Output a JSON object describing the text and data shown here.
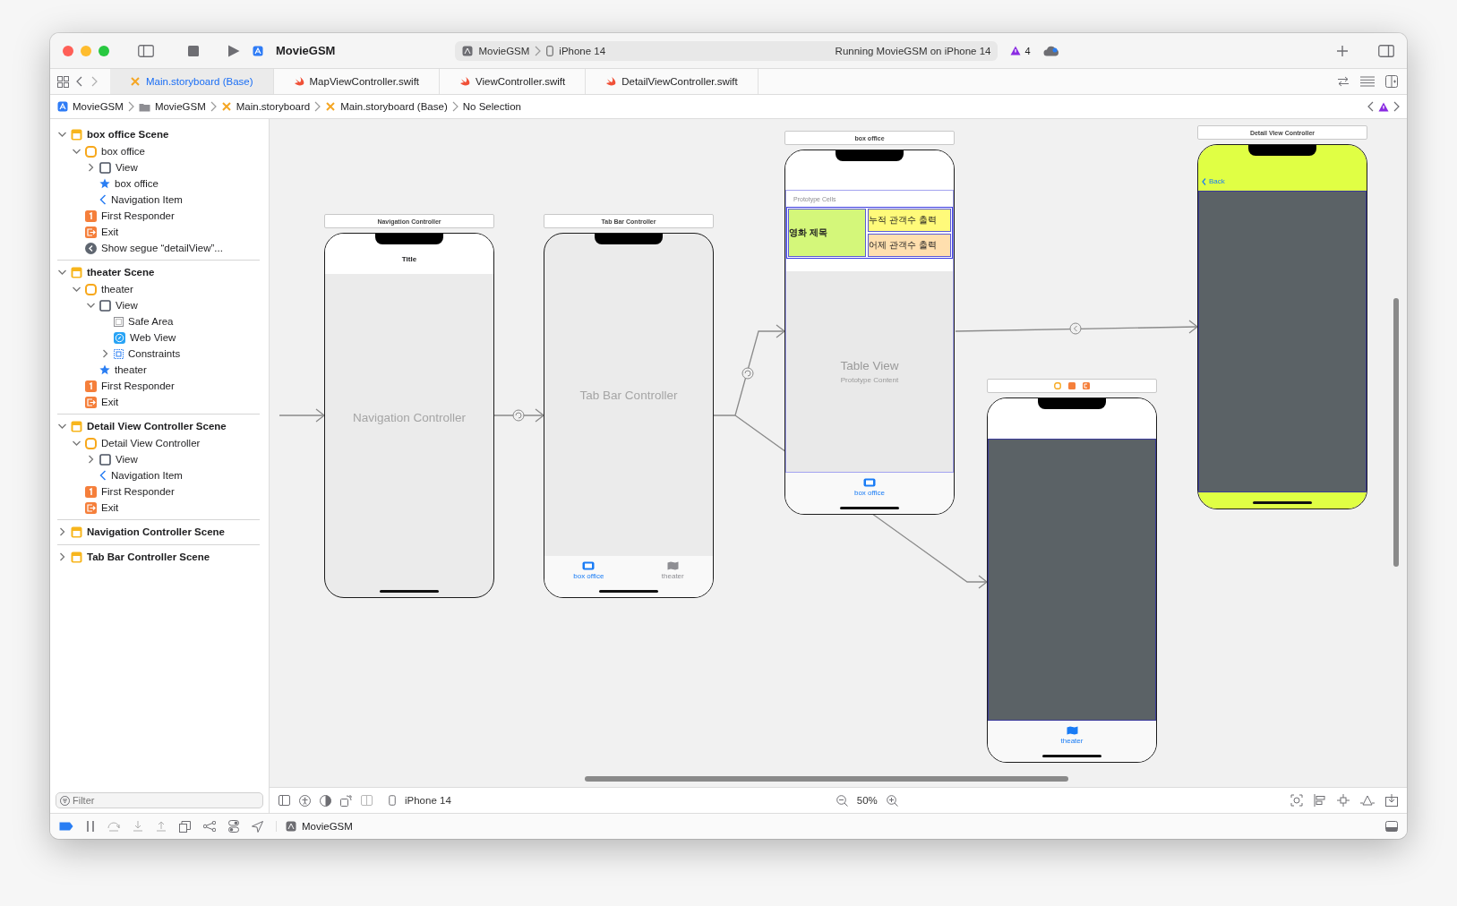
{
  "toolbar": {
    "project": "MovieGSM",
    "scheme": "MovieGSM",
    "device": "iPhone 14",
    "status": "Running MovieGSM on iPhone 14",
    "warnings": "4"
  },
  "tabs": [
    {
      "label": "Main.storyboard (Base)",
      "kind": "storyboard",
      "selected": true
    },
    {
      "label": "MapViewController.swift",
      "kind": "swift",
      "selected": false
    },
    {
      "label": "ViewController.swift",
      "kind": "swift",
      "selected": false
    },
    {
      "label": "DetailViewController.swift",
      "kind": "swift",
      "selected": false
    }
  ],
  "jump_bar": [
    {
      "label": "MovieGSM",
      "kind": "project"
    },
    {
      "label": "MovieGSM",
      "kind": "folder"
    },
    {
      "label": "Main.storyboard",
      "kind": "storyboard"
    },
    {
      "label": "Main.storyboard (Base)",
      "kind": "storyboard"
    },
    {
      "label": "No Selection",
      "kind": "text"
    }
  ],
  "outline": [
    {
      "label": "box office Scene",
      "kind": "scene",
      "expanded": true,
      "children": [
        {
          "label": "box office",
          "kind": "controller",
          "expanded": true,
          "children": [
            {
              "label": "View",
              "kind": "view",
              "expanded": false
            },
            {
              "label": "box office",
              "kind": "star"
            },
            {
              "label": "Navigation Item",
              "kind": "navitem"
            }
          ]
        },
        {
          "label": "First Responder",
          "kind": "responder"
        },
        {
          "label": "Exit",
          "kind": "exit"
        },
        {
          "label": "Show segue “detailView”...",
          "kind": "segue"
        }
      ]
    },
    {
      "label": "theater Scene",
      "kind": "scene",
      "expanded": true,
      "children": [
        {
          "label": "theater",
          "kind": "controller",
          "expanded": true,
          "children": [
            {
              "label": "View",
              "kind": "view",
              "expanded": true,
              "children": [
                {
                  "label": "Safe Area",
                  "kind": "safearea"
                },
                {
                  "label": "Web View",
                  "kind": "webview"
                },
                {
                  "label": "Constraints",
                  "kind": "constraints",
                  "expanded": false
                }
              ]
            },
            {
              "label": "theater",
              "kind": "star"
            }
          ]
        },
        {
          "label": "First Responder",
          "kind": "responder"
        },
        {
          "label": "Exit",
          "kind": "exit"
        }
      ]
    },
    {
      "label": "Detail View Controller Scene",
      "kind": "scene",
      "expanded": true,
      "children": [
        {
          "label": "Detail View Controller",
          "kind": "controller",
          "expanded": true,
          "children": [
            {
              "label": "View",
              "kind": "view",
              "expanded": false
            },
            {
              "label": "Navigation Item",
              "kind": "navitem"
            }
          ]
        },
        {
          "label": "First Responder",
          "kind": "responder"
        },
        {
          "label": "Exit",
          "kind": "exit"
        }
      ]
    },
    {
      "label": "Navigation Controller Scene",
      "kind": "scene",
      "expanded": false
    },
    {
      "label": "Tab Bar Controller Scene",
      "kind": "scene",
      "expanded": false
    }
  ],
  "filter": {
    "placeholder": "Filter"
  },
  "canvas": {
    "scenes": [
      {
        "kind": "navigation",
        "title": "Navigation Controller",
        "nav_title": "Title",
        "label": "Navigation Controller"
      },
      {
        "kind": "tabbar",
        "title": "Tab Bar Controller",
        "label": "Tab Bar Controller",
        "tab_items": [
          {
            "label": "box office",
            "kind": "tv",
            "selected": true
          },
          {
            "label": "theater",
            "kind": "map",
            "selected": false
          }
        ]
      },
      {
        "kind": "table",
        "title": "box office",
        "section": "Prototype Cells",
        "cell_title": "영화 제목",
        "cell_total": "누적 관객수 출력",
        "cell_yesterday": "어제 관객수 출력",
        "table_label": "Table View",
        "table_sublabel": "Prototype Content",
        "tab_items": [
          {
            "label": "box office",
            "kind": "tv",
            "selected": true
          }
        ]
      },
      {
        "kind": "web",
        "tab_items": [
          {
            "label": "theater",
            "kind": "map",
            "selected": true
          }
        ]
      },
      {
        "kind": "detail",
        "title": "Detail View Controller",
        "back": "Back"
      }
    ],
    "device": "iPhone 14",
    "zoom": "50%"
  },
  "debug_bar": {
    "target": "MovieGSM"
  }
}
